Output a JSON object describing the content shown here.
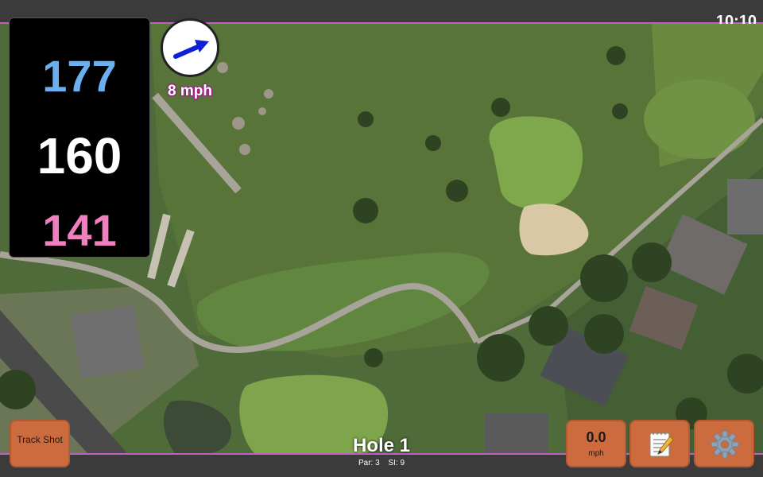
{
  "status": {
    "time": "10:10"
  },
  "distances": {
    "back": "177",
    "middle": "160",
    "front": "141"
  },
  "wind": {
    "speed": "8 mph",
    "arrow_icon": "wind-direction-arrow-icon"
  },
  "hole": {
    "title": "Hole 1",
    "par": "Par: 3",
    "si": "SI: 9"
  },
  "buttons": {
    "track_shot": "Track Shot",
    "speed_value": "0.0",
    "speed_unit": "mph",
    "notes_icon": "notepad-icon",
    "settings_icon": "gear-icon"
  },
  "colors": {
    "back_distance": "#6ab0f0",
    "middle_distance": "#ffffff",
    "front_distance": "#f07fc0",
    "button_bg": "#cc6b3e",
    "bar_accent": "#c060c0"
  }
}
